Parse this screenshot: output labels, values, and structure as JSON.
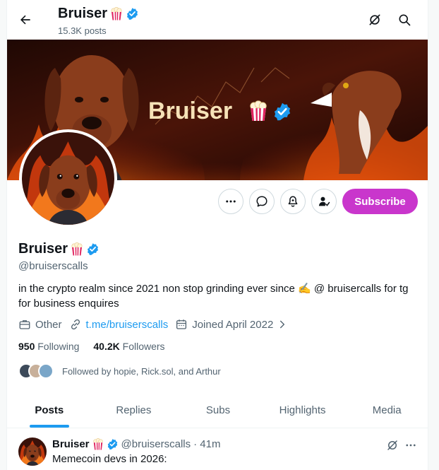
{
  "header": {
    "name": "Bruiser",
    "posts_count": "15.3K posts"
  },
  "banner": {
    "title": "Bruiser"
  },
  "actions": {
    "subscribe_label": "Subscribe"
  },
  "profile": {
    "name": "Bruiser",
    "handle": "@bruiserscalls",
    "bio": "in the crypto realm since 2021 non stop grinding ever since ✍️ @ bruisercalls for tg for business enquires",
    "category": "Other",
    "link": "t.me/bruiserscalls",
    "joined": "Joined April 2022",
    "following_count": "950",
    "following_label": "Following",
    "followers_count": "40.2K",
    "followers_label": "Followers",
    "followed_by": "Followed by hopie, Rick.sol, and Arthur"
  },
  "tabs": [
    {
      "label": "Posts"
    },
    {
      "label": "Replies"
    },
    {
      "label": "Subs"
    },
    {
      "label": "Highlights"
    },
    {
      "label": "Media"
    }
  ],
  "post": {
    "name": "Bruiser",
    "handle": "@bruiserscalls",
    "time": "· 41m",
    "text": "Memecoin devs in 2026:"
  },
  "colors": {
    "accent": "#1d9bf0",
    "subscribe": "#c936cc",
    "text": "#0f1419",
    "muted": "#536471"
  },
  "icons": [
    "back-arrow-icon",
    "grok-icon",
    "search-icon",
    "more-icon",
    "message-icon",
    "notification-bell-icon",
    "following-icon",
    "briefcase-icon",
    "link-icon",
    "calendar-icon",
    "chevron-right-icon",
    "verified-badge-icon",
    "popcorn-emoji-icon"
  ]
}
